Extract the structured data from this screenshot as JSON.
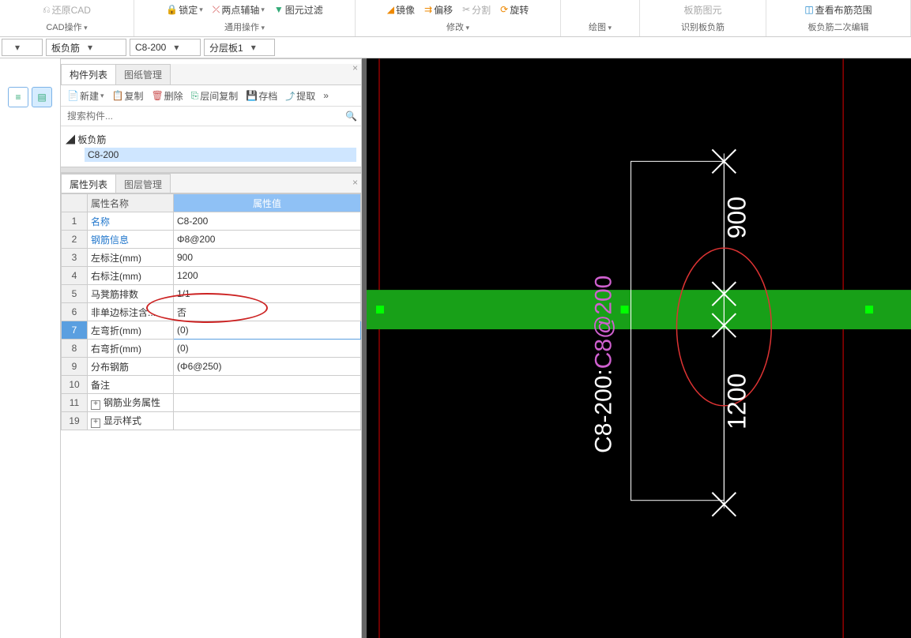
{
  "ribbon": {
    "g1": {
      "btn1": "还原CAD",
      "title": "CAD操作"
    },
    "g2": {
      "btn1": "锁定",
      "btn2": "两点辅轴",
      "btn3": "图元过滤",
      "title": "通用操作"
    },
    "g3": {
      "btn1": "镜像",
      "btn2": "偏移",
      "btn3": "分割",
      "btn4": "旋转",
      "title": "修改"
    },
    "g4": {
      "title": "绘图"
    },
    "g5": {
      "btn1": "板筋图元",
      "title": "识别板负筋"
    },
    "g6": {
      "btn1": "查看布筋范围",
      "title": "板负筋二次编辑"
    }
  },
  "combos": {
    "c1": "",
    "c2": "板负筋",
    "c3": "C8-200",
    "c4": "分层板1"
  },
  "component_panel": {
    "tab1": "构件列表",
    "tab2": "图纸管理",
    "tb": {
      "new": "新建",
      "copy": "复制",
      "del": "删除",
      "lcopy": "层间复制",
      "arch": "存档",
      "ext": "提取"
    },
    "search_ph": "搜索构件...",
    "tree_root": "板负筋",
    "tree_child": "C8-200"
  },
  "prop_panel": {
    "tab1": "属性列表",
    "tab2": "图层管理",
    "head_name": "属性名称",
    "head_val": "属性值",
    "rows": [
      {
        "i": "1",
        "n": "名称",
        "v": "C8-200",
        "link": true
      },
      {
        "i": "2",
        "n": "钢筋信息",
        "v": "Φ8@200",
        "link": true
      },
      {
        "i": "3",
        "n": "左标注(mm)",
        "v": "900"
      },
      {
        "i": "4",
        "n": "右标注(mm)",
        "v": "1200"
      },
      {
        "i": "5",
        "n": "马凳筋排数",
        "v": "1/1"
      },
      {
        "i": "6",
        "n": "非单边标注含...",
        "v": "否"
      },
      {
        "i": "7",
        "n": "左弯折(mm)",
        "v": "(0)",
        "sel": true
      },
      {
        "i": "8",
        "n": "右弯折(mm)",
        "v": "(0)"
      },
      {
        "i": "9",
        "n": "分布钢筋",
        "v": "(Φ6@250)"
      },
      {
        "i": "10",
        "n": "备注",
        "v": ""
      },
      {
        "i": "11",
        "n": "钢筋业务属性",
        "v": "",
        "exp": true
      },
      {
        "i": "19",
        "n": "显示样式",
        "v": "",
        "exp": true
      }
    ]
  },
  "canvas": {
    "label_full": "C8-200:C8@200",
    "label_part1": "C8-200:",
    "label_part2": "C8@200",
    "dim_top": "900",
    "dim_bot": "1200"
  }
}
